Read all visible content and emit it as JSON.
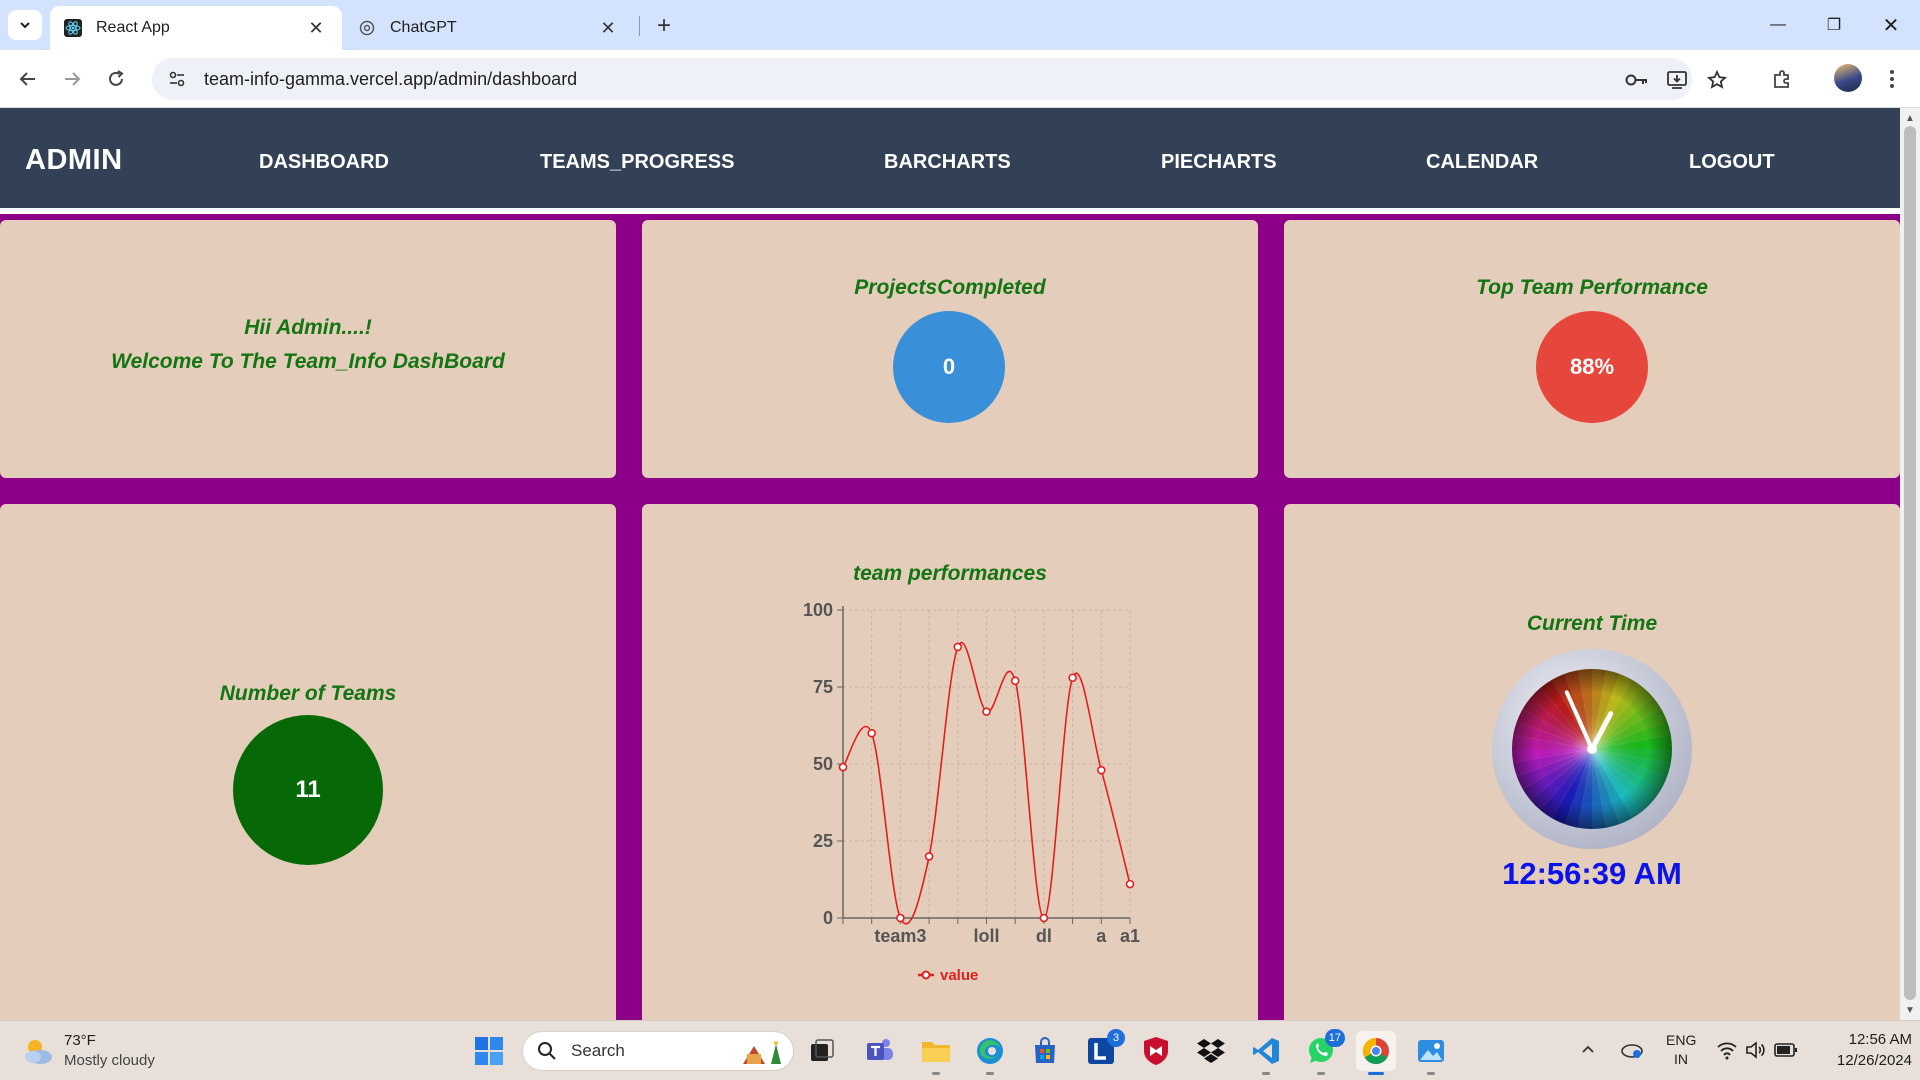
{
  "browser": {
    "tabs": [
      {
        "title": "React App",
        "active": true
      },
      {
        "title": "ChatGPT",
        "active": false
      }
    ],
    "url": "team-info-gamma.vercel.app/admin/dashboard"
  },
  "navbar": {
    "brand": "ADMIN",
    "links": [
      "DASHBOARD",
      "TEAMS_PROGRESS",
      "BARCHARTS",
      "PIECHARTS",
      "CALENDAR",
      "LOGOUT"
    ]
  },
  "welcome": {
    "line1": "Hii Admin....!",
    "line2": "Welcome To The Team_Info DashBoard"
  },
  "projects": {
    "title": "ProjectsCompleted",
    "value": "0",
    "color": "#3a8fd9"
  },
  "top_team": {
    "title": "Top Team Performance",
    "value": "88%",
    "color": "#e6473c"
  },
  "teams": {
    "title": "Number of Teams",
    "value": "11",
    "color": "#066806"
  },
  "clock": {
    "title": "Current Time",
    "time": "12:56:39 AM",
    "hour_hand_angle_deg": 28,
    "minute_hand_angle_deg": 336
  },
  "chart_data": {
    "type": "line",
    "title": "team performances",
    "x": [
      "",
      "",
      "team3",
      "",
      "",
      "loll",
      "",
      "dl",
      "",
      "a",
      "a1"
    ],
    "xtick_labels": [
      "team3",
      "loll",
      "dl",
      "a",
      "a1"
    ],
    "series": [
      {
        "name": "value",
        "values": [
          49,
          60,
          0,
          20,
          88,
          67,
          77,
          0,
          78,
          48,
          11
        ],
        "color": "#e02020"
      }
    ],
    "ylim": [
      0,
      100
    ],
    "yticks": [
      0,
      25,
      50,
      75,
      100
    ],
    "grid": true,
    "legend": "bottom"
  },
  "taskbar": {
    "weather": {
      "temp": "73°F",
      "desc": "Mostly cloudy"
    },
    "search_placeholder": "Search",
    "badges": {
      "outlook": "3",
      "whatsapp": "17"
    },
    "lang": {
      "line1": "ENG",
      "line2": "IN"
    },
    "time": "12:56 AM",
    "date": "12/26/2024"
  }
}
